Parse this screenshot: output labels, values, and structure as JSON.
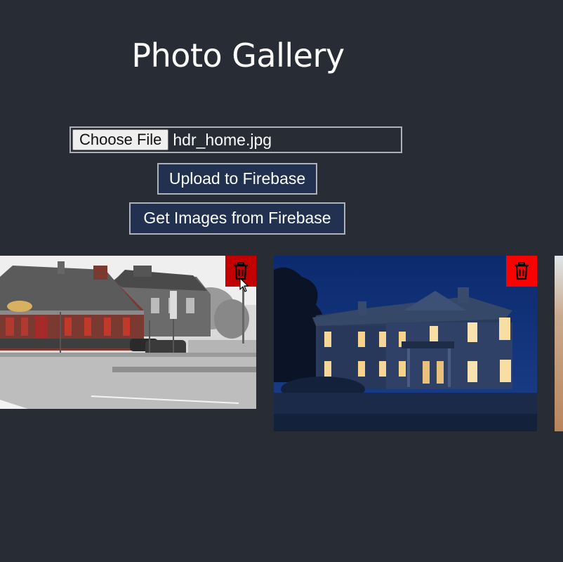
{
  "header": {
    "title": "Photo Gallery"
  },
  "upload_form": {
    "choose_file_label": "Choose File",
    "selected_file": "hdr_home.jpg",
    "upload_button_label": "Upload to Firebase",
    "get_images_button_label": "Get Images from Firebase"
  },
  "gallery": {
    "images": [
      {
        "description": "grayscale street with red-brick building",
        "delete_icon": "trash-icon",
        "delete_state": "hovered"
      },
      {
        "description": "white house at dusk with lit windows",
        "delete_icon": "trash-icon",
        "delete_state": "normal"
      },
      {
        "description": "desert dune (partially visible)",
        "delete_icon": "trash-icon",
        "delete_state": "normal"
      }
    ]
  },
  "colors": {
    "background": "#282c34",
    "button_background": "#21314f",
    "button_border": "#aeb1b7",
    "delete_normal": "#ff0000",
    "delete_hover": "#c30000"
  }
}
